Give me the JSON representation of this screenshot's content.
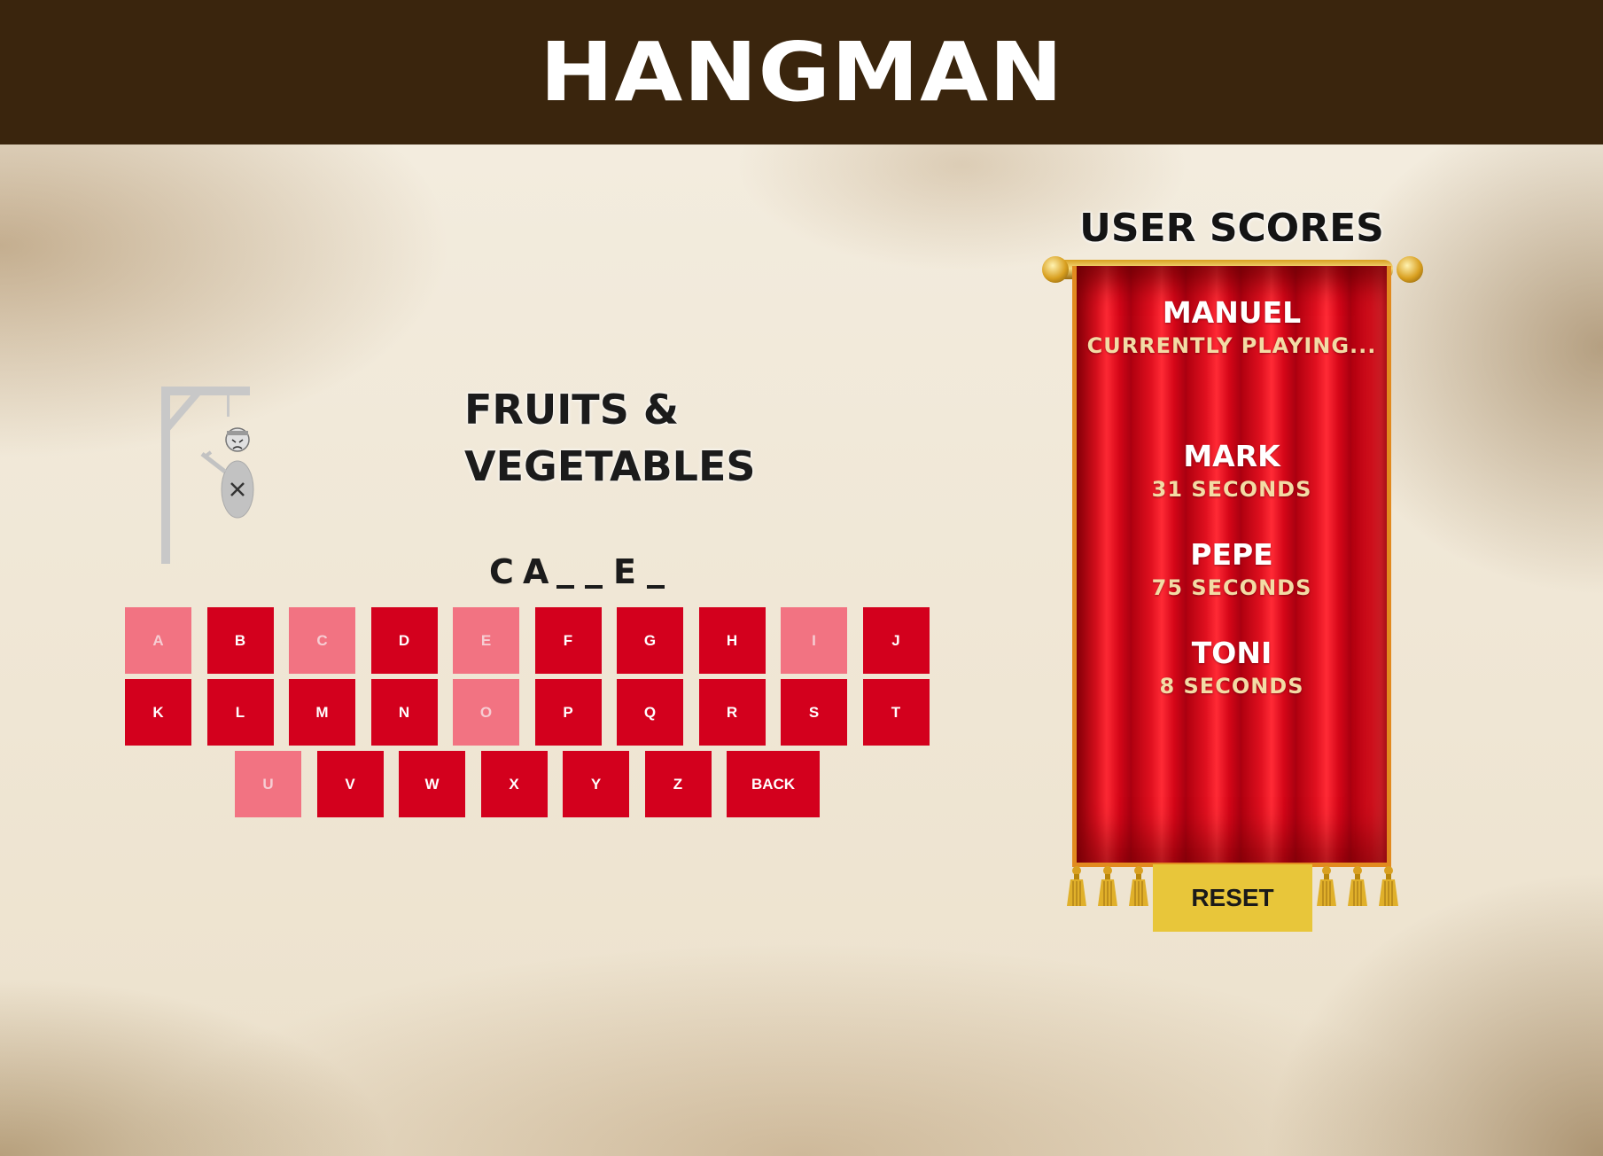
{
  "header": {
    "title": "HANGMAN"
  },
  "game": {
    "category_line1": "FRUITS &",
    "category_line2": "VEGETABLES",
    "word": [
      "C",
      "A",
      "_",
      "_",
      "E",
      "_"
    ],
    "keys_row1": [
      {
        "label": "A",
        "used": true
      },
      {
        "label": "B",
        "used": false
      },
      {
        "label": "C",
        "used": true
      },
      {
        "label": "D",
        "used": false
      },
      {
        "label": "E",
        "used": true
      },
      {
        "label": "F",
        "used": false
      },
      {
        "label": "G",
        "used": false
      },
      {
        "label": "H",
        "used": false
      },
      {
        "label": "I",
        "used": true
      },
      {
        "label": "J",
        "used": false
      }
    ],
    "keys_row2": [
      {
        "label": "K",
        "used": false
      },
      {
        "label": "L",
        "used": false
      },
      {
        "label": "M",
        "used": false
      },
      {
        "label": "N",
        "used": false
      },
      {
        "label": "O",
        "used": true
      },
      {
        "label": "P",
        "used": false
      },
      {
        "label": "Q",
        "used": false
      },
      {
        "label": "R",
        "used": false
      },
      {
        "label": "S",
        "used": false
      },
      {
        "label": "T",
        "used": false
      }
    ],
    "keys_row3": [
      {
        "label": "U",
        "used": true
      },
      {
        "label": "V",
        "used": false
      },
      {
        "label": "W",
        "used": false
      },
      {
        "label": "X",
        "used": false
      },
      {
        "label": "Y",
        "used": false
      },
      {
        "label": "Z",
        "used": false
      },
      {
        "label": "BACK",
        "used": false
      }
    ]
  },
  "scores": {
    "title": "USER SCORES",
    "current": {
      "name": "MANUEL",
      "status": "CURRENTLY PLAYING..."
    },
    "entries": [
      {
        "name": "MARK",
        "time": "31 SECONDS"
      },
      {
        "name": "PEPE",
        "time": "75 SECONDS"
      },
      {
        "name": "TONI",
        "time": "8 SECONDS"
      }
    ],
    "reset_label": "RESET"
  },
  "colors": {
    "header_bg": "#3a250d",
    "key_active": "#d3001d",
    "key_used": "#f27382",
    "banner_red": "#cc0016",
    "reset_yellow": "#e8c63a"
  }
}
